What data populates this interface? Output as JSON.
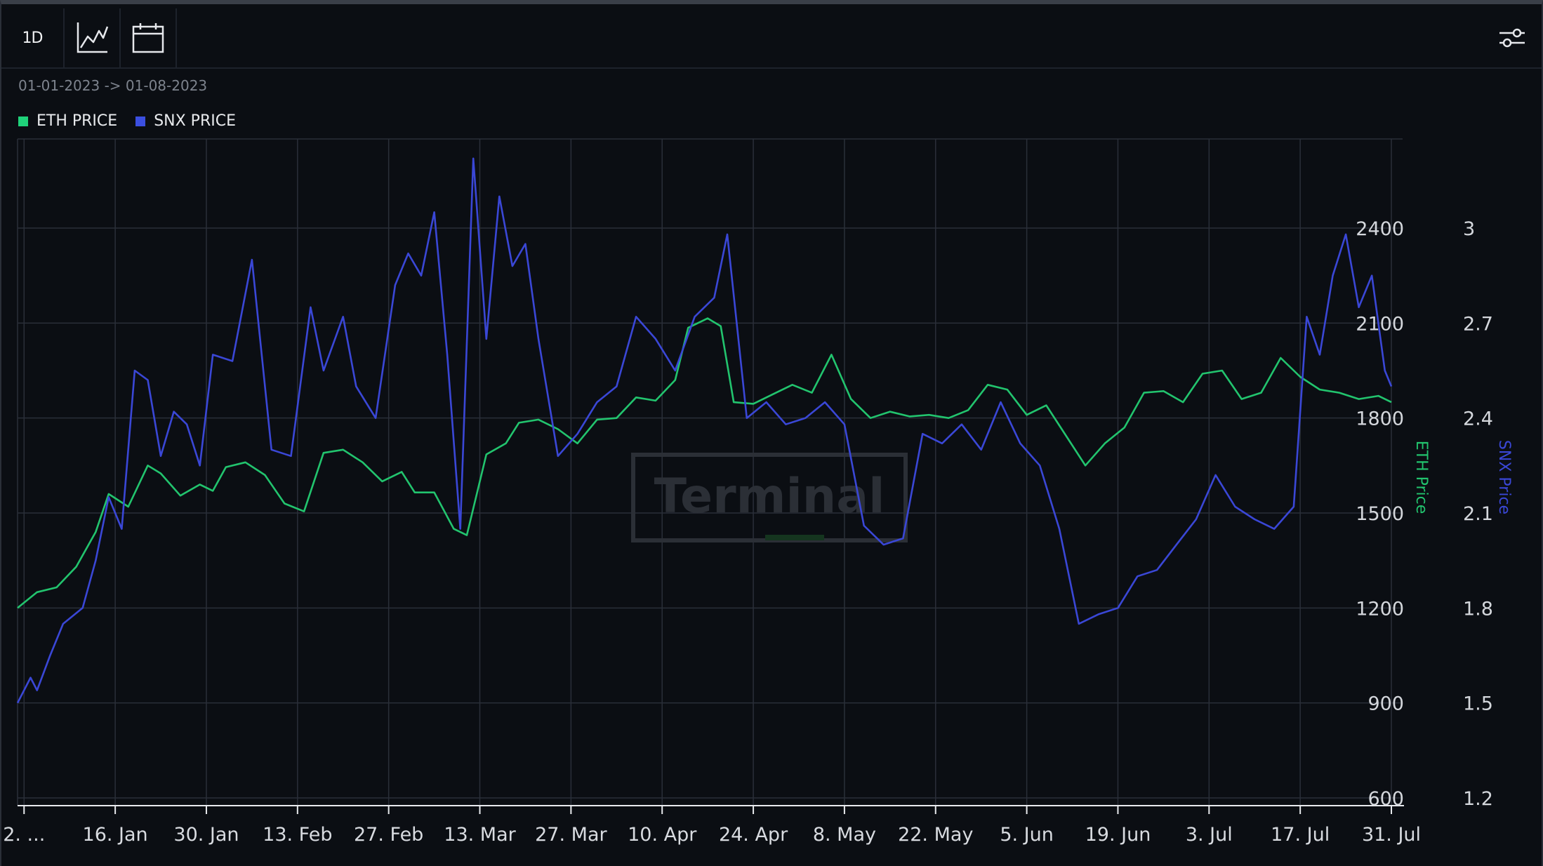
{
  "toolbar": {
    "interval_label": "1D",
    "icons": [
      "line-chart-icon",
      "calendar-icon",
      "settings-sliders-icon"
    ]
  },
  "date_range": "01-01-2023 -> 01-08-2023",
  "legend": [
    {
      "label": "ETH PRICE",
      "color": "#1fd27a"
    },
    {
      "label": "SNX PRICE",
      "color": "#3b4fe0"
    }
  ],
  "watermark": "Terminal",
  "colors": {
    "eth": "#22c46e",
    "snx": "#3a47d6",
    "grid": "#2a2f39",
    "axis_text": "#d4d7dc",
    "background": "#0b0e13"
  },
  "chart_data": {
    "type": "line",
    "x_tick_labels": [
      "2. ...",
      "16. Jan",
      "30. Jan",
      "13. Feb",
      "27. Feb",
      "13. Mar",
      "27. Mar",
      "10. Apr",
      "24. Apr",
      "8. May",
      "22. May",
      "5. Jun",
      "19. Jun",
      "3. Jul",
      "17. Jul",
      "31. Jul"
    ],
    "x_start": "2023-01-01",
    "x_end": "2023-07-31",
    "y_left": {
      "label": "ETH Price",
      "ticks": [
        600,
        900,
        1200,
        1500,
        1800,
        2100,
        2400
      ],
      "range": [
        600,
        2700
      ]
    },
    "y_right": {
      "label": "SNX Price",
      "ticks": [
        "1.2",
        "1.5",
        "1.8",
        "2.1",
        "2.4",
        "2.7",
        "3"
      ],
      "range": [
        1.2,
        3.3
      ]
    },
    "series": [
      {
        "name": "ETH PRICE",
        "axis": "left",
        "points": [
          [
            "2023-01-01",
            1200
          ],
          [
            "2023-01-04",
            1250
          ],
          [
            "2023-01-07",
            1265
          ],
          [
            "2023-01-10",
            1330
          ],
          [
            "2023-01-13",
            1440
          ],
          [
            "2023-01-15",
            1560
          ],
          [
            "2023-01-18",
            1520
          ],
          [
            "2023-01-21",
            1650
          ],
          [
            "2023-01-23",
            1625
          ],
          [
            "2023-01-26",
            1555
          ],
          [
            "2023-01-29",
            1590
          ],
          [
            "2023-01-31",
            1570
          ],
          [
            "2023-02-02",
            1645
          ],
          [
            "2023-02-05",
            1660
          ],
          [
            "2023-02-08",
            1620
          ],
          [
            "2023-02-11",
            1530
          ],
          [
            "2023-02-14",
            1505
          ],
          [
            "2023-02-17",
            1690
          ],
          [
            "2023-02-20",
            1700
          ],
          [
            "2023-02-23",
            1660
          ],
          [
            "2023-02-26",
            1600
          ],
          [
            "2023-03-01",
            1630
          ],
          [
            "2023-03-03",
            1565
          ],
          [
            "2023-03-06",
            1565
          ],
          [
            "2023-03-09",
            1450
          ],
          [
            "2023-03-11",
            1430
          ],
          [
            "2023-03-14",
            1685
          ],
          [
            "2023-03-17",
            1720
          ],
          [
            "2023-03-19",
            1785
          ],
          [
            "2023-03-22",
            1795
          ],
          [
            "2023-03-25",
            1765
          ],
          [
            "2023-03-28",
            1720
          ],
          [
            "2023-03-31",
            1795
          ],
          [
            "2023-04-03",
            1800
          ],
          [
            "2023-04-06",
            1865
          ],
          [
            "2023-04-09",
            1855
          ],
          [
            "2023-04-12",
            1920
          ],
          [
            "2023-04-14",
            2085
          ],
          [
            "2023-04-17",
            2115
          ],
          [
            "2023-04-19",
            2090
          ],
          [
            "2023-04-21",
            1850
          ],
          [
            "2023-04-24",
            1845
          ],
          [
            "2023-04-27",
            1875
          ],
          [
            "2023-04-30",
            1905
          ],
          [
            "2023-05-03",
            1880
          ],
          [
            "2023-05-06",
            2000
          ],
          [
            "2023-05-09",
            1860
          ],
          [
            "2023-05-12",
            1800
          ],
          [
            "2023-05-15",
            1820
          ],
          [
            "2023-05-18",
            1805
          ],
          [
            "2023-05-21",
            1810
          ],
          [
            "2023-05-24",
            1800
          ],
          [
            "2023-05-27",
            1825
          ],
          [
            "2023-05-30",
            1905
          ],
          [
            "2023-06-02",
            1890
          ],
          [
            "2023-06-05",
            1810
          ],
          [
            "2023-06-08",
            1840
          ],
          [
            "2023-06-11",
            1745
          ],
          [
            "2023-06-14",
            1650
          ],
          [
            "2023-06-17",
            1720
          ],
          [
            "2023-06-20",
            1770
          ],
          [
            "2023-06-23",
            1880
          ],
          [
            "2023-06-26",
            1885
          ],
          [
            "2023-06-29",
            1850
          ],
          [
            "2023-07-02",
            1940
          ],
          [
            "2023-07-05",
            1950
          ],
          [
            "2023-07-08",
            1860
          ],
          [
            "2023-07-11",
            1880
          ],
          [
            "2023-07-14",
            1990
          ],
          [
            "2023-07-17",
            1930
          ],
          [
            "2023-07-20",
            1890
          ],
          [
            "2023-07-23",
            1880
          ],
          [
            "2023-07-26",
            1860
          ],
          [
            "2023-07-29",
            1870
          ],
          [
            "2023-07-31",
            1850
          ]
        ]
      },
      {
        "name": "SNX PRICE",
        "axis": "right",
        "points": [
          [
            "2023-01-01",
            1.5
          ],
          [
            "2023-01-03",
            1.58
          ],
          [
            "2023-01-04",
            1.54
          ],
          [
            "2023-01-06",
            1.65
          ],
          [
            "2023-01-08",
            1.75
          ],
          [
            "2023-01-11",
            1.8
          ],
          [
            "2023-01-13",
            1.95
          ],
          [
            "2023-01-15",
            2.15
          ],
          [
            "2023-01-17",
            2.05
          ],
          [
            "2023-01-19",
            2.55
          ],
          [
            "2023-01-21",
            2.52
          ],
          [
            "2023-01-23",
            2.28
          ],
          [
            "2023-01-25",
            2.42
          ],
          [
            "2023-01-27",
            2.38
          ],
          [
            "2023-01-29",
            2.25
          ],
          [
            "2023-01-31",
            2.6
          ],
          [
            "2023-02-03",
            2.58
          ],
          [
            "2023-02-06",
            2.9
          ],
          [
            "2023-02-09",
            2.3
          ],
          [
            "2023-02-12",
            2.28
          ],
          [
            "2023-02-15",
            2.75
          ],
          [
            "2023-02-17",
            2.55
          ],
          [
            "2023-02-20",
            2.72
          ],
          [
            "2023-02-22",
            2.5
          ],
          [
            "2023-02-25",
            2.4
          ],
          [
            "2023-02-28",
            2.82
          ],
          [
            "2023-03-02",
            2.92
          ],
          [
            "2023-03-04",
            2.85
          ],
          [
            "2023-03-06",
            3.05
          ],
          [
            "2023-03-08",
            2.6
          ],
          [
            "2023-03-10",
            2.05
          ],
          [
            "2023-03-12",
            3.22
          ],
          [
            "2023-03-14",
            2.65
          ],
          [
            "2023-03-16",
            3.1
          ],
          [
            "2023-03-18",
            2.88
          ],
          [
            "2023-03-20",
            2.95
          ],
          [
            "2023-03-22",
            2.65
          ],
          [
            "2023-03-25",
            2.28
          ],
          [
            "2023-03-28",
            2.35
          ],
          [
            "2023-03-31",
            2.45
          ],
          [
            "2023-04-03",
            2.5
          ],
          [
            "2023-04-06",
            2.72
          ],
          [
            "2023-04-09",
            2.65
          ],
          [
            "2023-04-12",
            2.55
          ],
          [
            "2023-04-15",
            2.72
          ],
          [
            "2023-04-18",
            2.78
          ],
          [
            "2023-04-20",
            2.98
          ],
          [
            "2023-04-23",
            2.4
          ],
          [
            "2023-04-26",
            2.45
          ],
          [
            "2023-04-29",
            2.38
          ],
          [
            "2023-05-02",
            2.4
          ],
          [
            "2023-05-05",
            2.45
          ],
          [
            "2023-05-08",
            2.38
          ],
          [
            "2023-05-11",
            2.06
          ],
          [
            "2023-05-14",
            2.0
          ],
          [
            "2023-05-17",
            2.02
          ],
          [
            "2023-05-20",
            2.35
          ],
          [
            "2023-05-23",
            2.32
          ],
          [
            "2023-05-26",
            2.38
          ],
          [
            "2023-05-29",
            2.3
          ],
          [
            "2023-06-01",
            2.45
          ],
          [
            "2023-06-04",
            2.32
          ],
          [
            "2023-06-07",
            2.25
          ],
          [
            "2023-06-10",
            2.05
          ],
          [
            "2023-06-13",
            1.75
          ],
          [
            "2023-06-16",
            1.78
          ],
          [
            "2023-06-19",
            1.8
          ],
          [
            "2023-06-22",
            1.9
          ],
          [
            "2023-06-25",
            1.92
          ],
          [
            "2023-06-28",
            2.0
          ],
          [
            "2023-07-01",
            2.08
          ],
          [
            "2023-07-04",
            2.22
          ],
          [
            "2023-07-07",
            2.12
          ],
          [
            "2023-07-10",
            2.08
          ],
          [
            "2023-07-13",
            2.05
          ],
          [
            "2023-07-16",
            2.12
          ],
          [
            "2023-07-18",
            2.72
          ],
          [
            "2023-07-20",
            2.6
          ],
          [
            "2023-07-22",
            2.85
          ],
          [
            "2023-07-24",
            2.98
          ],
          [
            "2023-07-26",
            2.75
          ],
          [
            "2023-07-28",
            2.85
          ],
          [
            "2023-07-30",
            2.55
          ],
          [
            "2023-07-31",
            2.5
          ]
        ]
      }
    ],
    "grid": true,
    "legend_position": "top-left"
  }
}
